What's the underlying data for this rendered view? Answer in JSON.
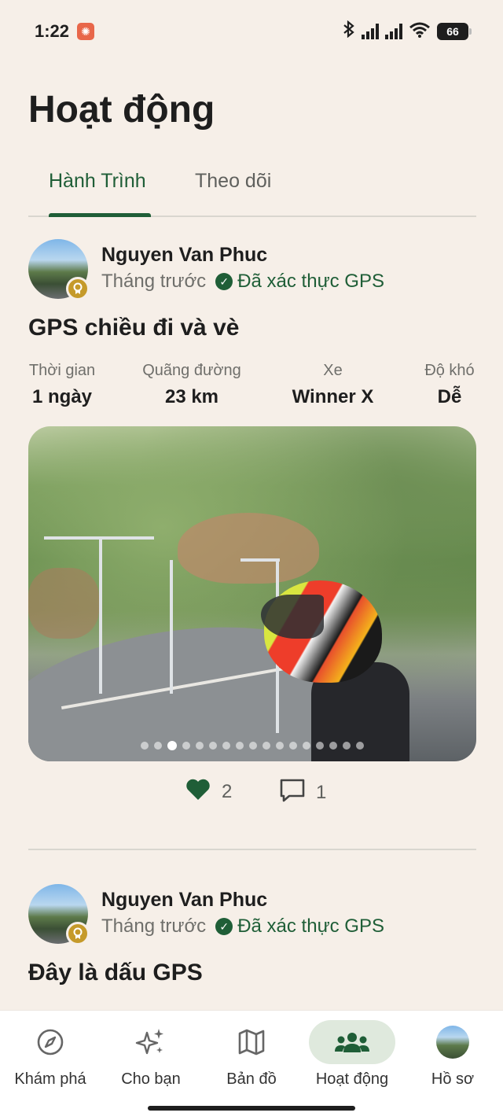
{
  "status_bar": {
    "time": "1:22",
    "notification_glyph": "✺",
    "battery": "66"
  },
  "page_title": "Hoạt động",
  "tabs": [
    {
      "label": "Hành Trình",
      "active": true
    },
    {
      "label": "Theo dõi",
      "active": false
    }
  ],
  "posts": [
    {
      "author": "Nguyen Van Phuc",
      "time_ago": "Tháng trước",
      "verified_label": "Đã xác thực GPS",
      "title": "GPS chiều đi và vè",
      "stats": [
        {
          "label": "Thời gian",
          "value": "1 ngày"
        },
        {
          "label": "Quãng đường",
          "value": "23 km"
        },
        {
          "label": "Xe",
          "value": "Winner X"
        },
        {
          "label": "Độ khó",
          "value": "Dễ"
        }
      ],
      "photo_count": 17,
      "active_photo_index": 2,
      "likes": "2",
      "comments": "1"
    },
    {
      "author": "Nguyen Van Phuc",
      "time_ago": "Tháng trước",
      "verified_label": "Đã xác thực GPS",
      "title": "Đây là dấu GPS"
    }
  ],
  "bottom_nav": [
    {
      "label": "Khám phá",
      "icon": "compass-icon"
    },
    {
      "label": "Cho bạn",
      "icon": "sparkles-icon"
    },
    {
      "label": "Bản đồ",
      "icon": "map-icon"
    },
    {
      "label": "Hoạt động",
      "icon": "group-icon",
      "active": true
    },
    {
      "label": "Hồ sơ",
      "icon": "avatar"
    }
  ],
  "colors": {
    "accent": "#1f5e37",
    "background": "#f6efe8",
    "nav_active_pill": "#dfe9dd"
  }
}
